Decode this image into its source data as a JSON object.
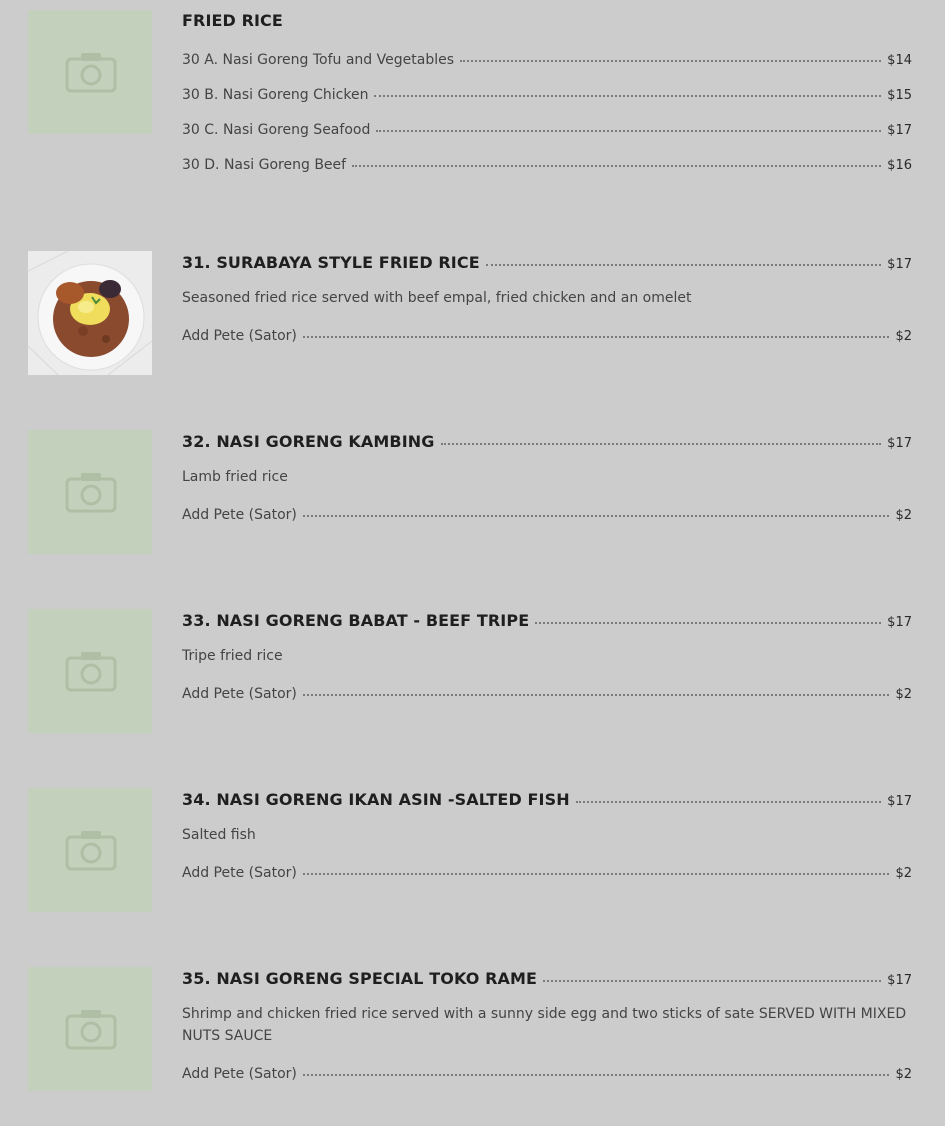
{
  "colors": {
    "background": "#cccccc",
    "placeholder": "#c3d1bc",
    "camera": "#aebfa6"
  },
  "icons": {
    "placeholder": "camera-icon"
  },
  "sections": [
    {
      "title": "FRIED RICE",
      "items": [
        {
          "name": "30 A. Nasi Goreng Tofu and Vegetables",
          "price": "$14"
        },
        {
          "name": "30 B. Nasi Goreng Chicken",
          "price": "$15"
        },
        {
          "name": "30 C. Nasi Goreng Seafood",
          "price": "$17"
        },
        {
          "name": "30 D. Nasi Goreng Beef",
          "price": "$16"
        }
      ]
    },
    {
      "title": "31. SURABAYA STYLE FRIED RICE",
      "price": "$17",
      "description": "Seasoned fried rice served with beef empal, fried chicken and an omelet",
      "addon": "Add Pete (Sator)",
      "addon_price": "$2"
    },
    {
      "title": "32. NASI GORENG KAMBING",
      "price": "$17",
      "description": "Lamb fried rice",
      "addon": "Add Pete (Sator)",
      "addon_price": "$2"
    },
    {
      "title": "33. NASI GORENG BABAT - BEEF TRIPE",
      "price": "$17",
      "description": "Tripe fried rice",
      "addon": "Add Pete (Sator)",
      "addon_price": "$2"
    },
    {
      "title": "34. NASI GORENG IKAN ASIN -SALTED FISH",
      "price": "$17",
      "description": "Salted fish",
      "addon": "Add Pete (Sator)",
      "addon_price": "$2"
    },
    {
      "title": "35. NASI GORENG SPECIAL TOKO RAME",
      "price": "$17",
      "description": "Shrimp and chicken fried rice served with a sunny side egg and two sticks of sate SERVED WITH MIXED NUTS SAUCE",
      "addon": "Add Pete (Sator)",
      "addon_price": "$2"
    }
  ]
}
